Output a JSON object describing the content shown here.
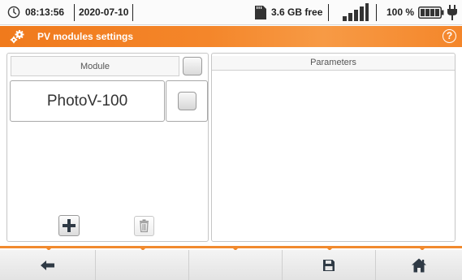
{
  "status": {
    "time": "08:13:56",
    "date": "2020-07-10",
    "storage_free": "3.6 GB free",
    "battery": "100 %",
    "icons": [
      "clock-icon",
      "sd-card-icon",
      "signal-icon",
      "battery-icon",
      "plug-icon"
    ]
  },
  "title": {
    "text": "PV modules settings",
    "icons": [
      "gear-icon",
      "help-icon"
    ],
    "help_glyph": "?"
  },
  "modules": {
    "column_header": "Module",
    "items": [
      {
        "name": "PhotoV-100",
        "checked": false
      }
    ],
    "header_checked": false
  },
  "parameters": {
    "column_header": "Parameters"
  },
  "toolbar": {
    "buttons": [
      "back-arrow-icon",
      "",
      "",
      "save-icon",
      "home-icon"
    ]
  },
  "colors": {
    "accent": "#f07a1c",
    "panel_border": "#c6c6c6"
  }
}
